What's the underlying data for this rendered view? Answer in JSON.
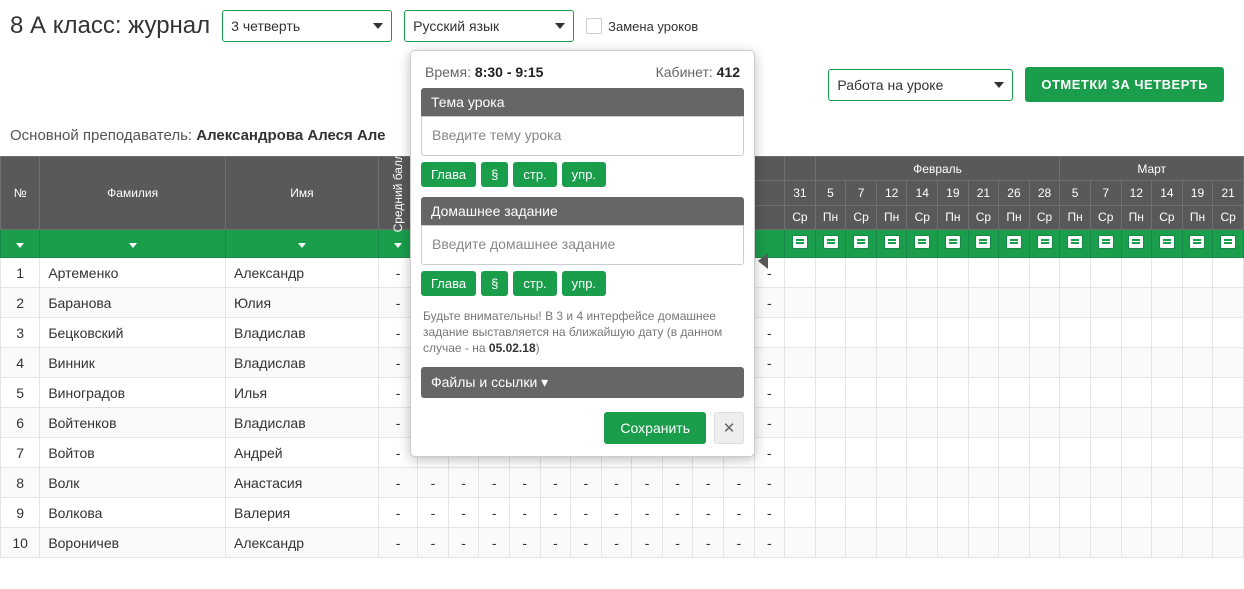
{
  "header": {
    "title": "8 А класс: журнал",
    "term_select": "3 четверть",
    "subject_select": "Русский язык",
    "replace_label": "Замена уроков"
  },
  "actions": {
    "work_select": "Работа на уроке",
    "marks_btn": "ОТМЕТКИ ЗА ЧЕТВЕРТЬ"
  },
  "teacher": {
    "label": "Основной преподаватель:",
    "name": "Александрова Алеся Але"
  },
  "table": {
    "num_header": "№",
    "last_header": "Фамилия",
    "first_header": "Имя",
    "avg_header": "Средний балл",
    "months": [
      "Февраль",
      "Март"
    ],
    "first_date": {
      "day": "31",
      "wd": "Ср"
    },
    "feb_days": [
      {
        "day": "5",
        "wd": "Пн"
      },
      {
        "day": "7",
        "wd": "Ср"
      },
      {
        "day": "12",
        "wd": "Пн"
      },
      {
        "day": "14",
        "wd": "Ср"
      },
      {
        "day": "19",
        "wd": "Пн"
      },
      {
        "day": "21",
        "wd": "Ср"
      },
      {
        "day": "26",
        "wd": "Пн"
      },
      {
        "day": "28",
        "wd": "Ср"
      }
    ],
    "mar_days": [
      {
        "day": "5",
        "wd": "Пн"
      },
      {
        "day": "7",
        "wd": "Ср"
      },
      {
        "day": "12",
        "wd": "Пн"
      },
      {
        "day": "14",
        "wd": "Ср"
      },
      {
        "day": "19",
        "wd": "Пн"
      },
      {
        "day": "21",
        "wd": "Ср"
      }
    ],
    "rows": [
      {
        "n": "1",
        "last": "Артеменко",
        "first": "Александр",
        "avg": "-"
      },
      {
        "n": "2",
        "last": "Баранова",
        "first": "Юлия",
        "avg": "-"
      },
      {
        "n": "3",
        "last": "Бецковский",
        "first": "Владислав",
        "avg": "-"
      },
      {
        "n": "4",
        "last": "Винник",
        "first": "Владислав",
        "avg": "-"
      },
      {
        "n": "5",
        "last": "Виноградов",
        "first": "Илья",
        "avg": "-"
      },
      {
        "n": "6",
        "last": "Войтенков",
        "first": "Владислав",
        "avg": "-"
      },
      {
        "n": "7",
        "last": "Войтов",
        "first": "Андрей",
        "avg": "-"
      },
      {
        "n": "8",
        "last": "Волк",
        "first": "Анастасия",
        "avg": "-"
      },
      {
        "n": "9",
        "last": "Волкова",
        "first": "Валерия",
        "avg": "-"
      },
      {
        "n": "10",
        "last": "Вороничев",
        "first": "Александр",
        "avg": "-"
      }
    ],
    "hidden_col_count": 12
  },
  "popup": {
    "time_label": "Время:",
    "time_value": "8:30 - 9:15",
    "room_label": "Кабинет:",
    "room_value": "412",
    "topic_head": "Тема урока",
    "topic_placeholder": "Введите тему урока",
    "chips": [
      "Глава",
      "§",
      "стр.",
      "упр."
    ],
    "hw_head": "Домашнее задание",
    "hw_placeholder": "Введите домашнее задание",
    "note_prefix": "Будьте внимательны! В 3 и 4 интерфейсе домашнее задание выставляется на ближайшую дату (в данном случае - на ",
    "note_date": "05.02.18",
    "note_suffix": ")",
    "files_label": "Файлы и ссылки  ▾",
    "save": "Сохранить",
    "close": "✕"
  }
}
